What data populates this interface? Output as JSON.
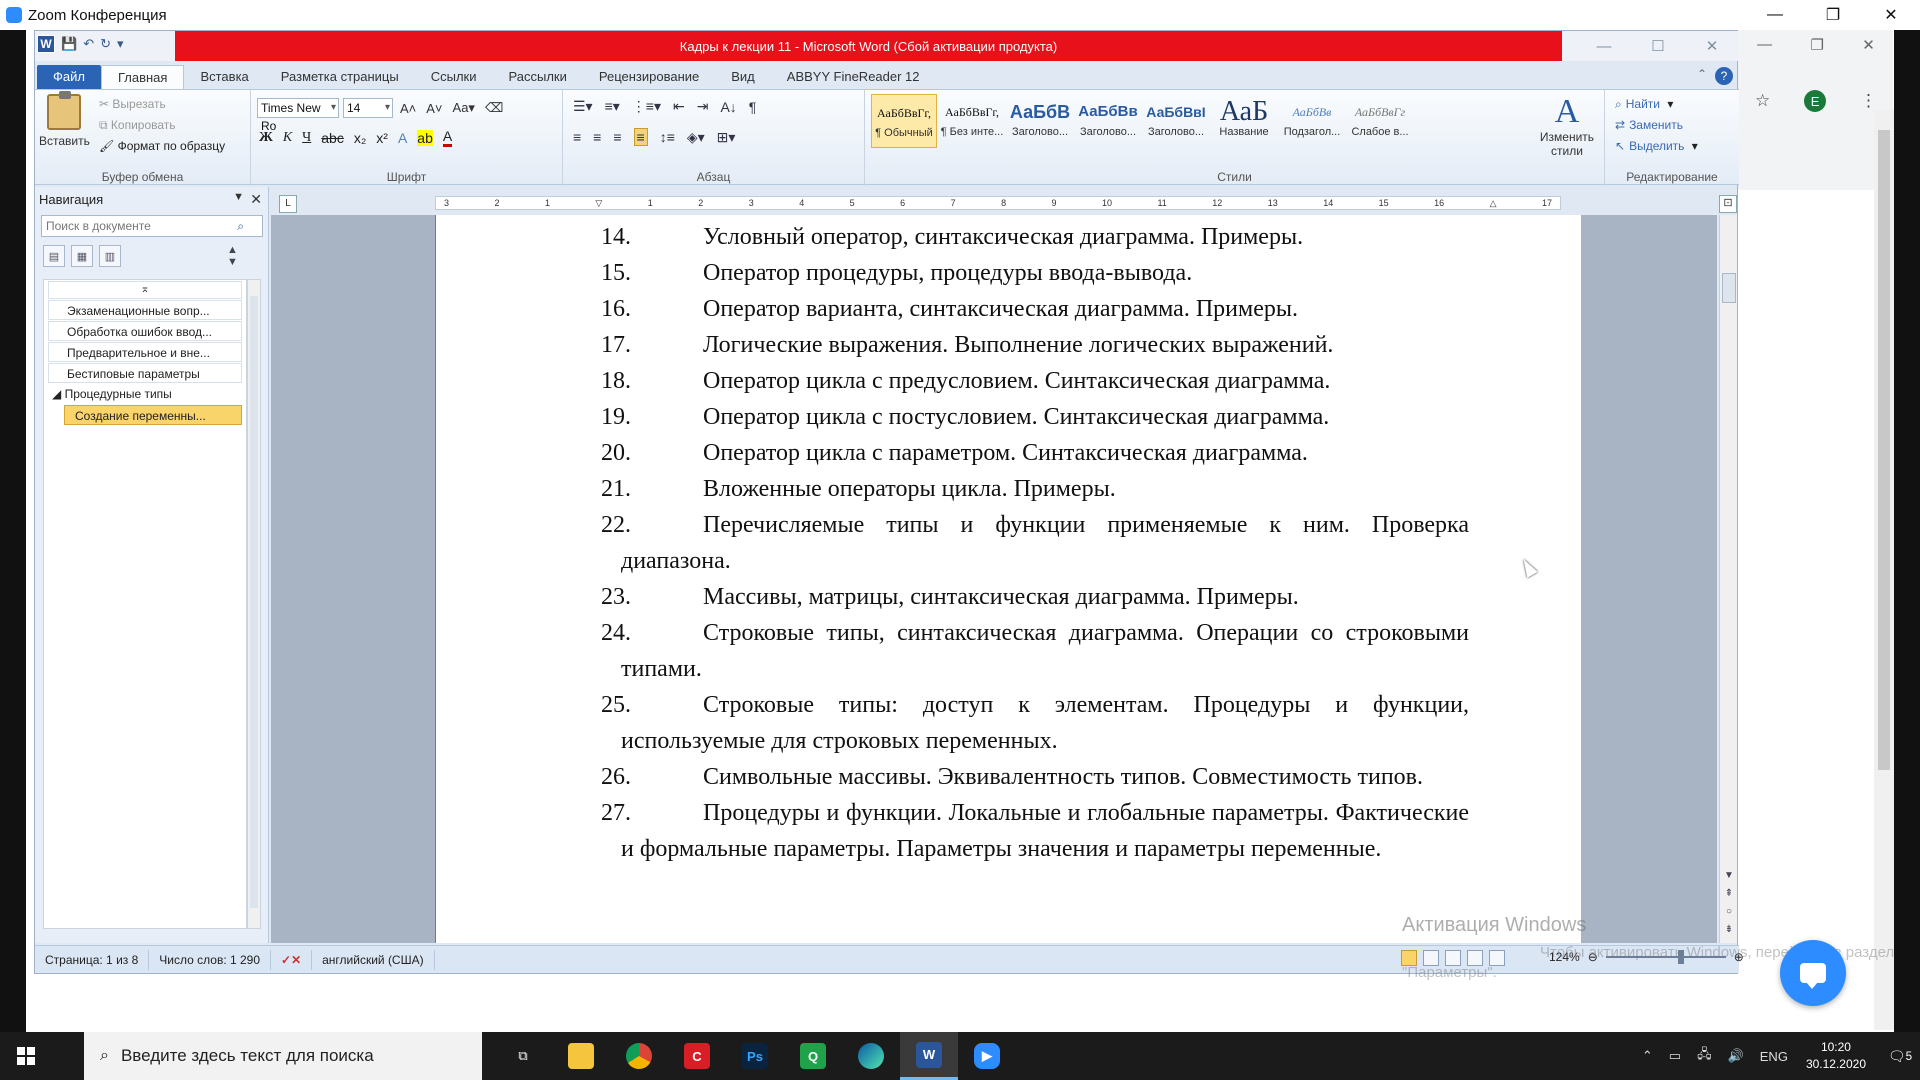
{
  "zoom": {
    "title": "Zoom Конференция",
    "controls": [
      "—",
      "❐",
      "✕"
    ]
  },
  "browser_bg": {
    "controls": [
      "—",
      "❐",
      "✕"
    ],
    "star": "☆",
    "avatar": "E",
    "menu": "⋮"
  },
  "word": {
    "title": "Кадры к лекции 11 - Microsoft Word (Сбой активации продукта)",
    "window_controls": [
      "—",
      "☐",
      "✕"
    ],
    "tabs": [
      "Файл",
      "Главная",
      "Вставка",
      "Разметка страницы",
      "Ссылки",
      "Рассылки",
      "Рецензирование",
      "Вид",
      "ABBYY FineReader 12"
    ],
    "help": "?",
    "clipboard": {
      "paste": "Вставить",
      "cut": "Вырезать",
      "copy": "Копировать",
      "format_painter": "Формат по образцу",
      "group": "Буфер обмена"
    },
    "font": {
      "name": "Times New Ro",
      "size": "14",
      "group": "Шрифт"
    },
    "paragraph": {
      "group": "Абзац"
    },
    "styles": {
      "items": [
        {
          "sample": "АаБбВвГг,",
          "name": "¶ Обычный"
        },
        {
          "sample": "АаБбВвГг,",
          "name": "¶ Без инте..."
        },
        {
          "sample": "АаБбВ",
          "name": "Заголово..."
        },
        {
          "sample": "АаБбВв",
          "name": "Заголово..."
        },
        {
          "sample": "АаБбВвІ",
          "name": "Заголово..."
        },
        {
          "sample": "АаБ",
          "name": "Название"
        },
        {
          "sample": "АаБбВв",
          "name": "Подзагол..."
        },
        {
          "sample": "АаБбВвГг",
          "name": "Слабое в..."
        }
      ],
      "change": "Изменить стили",
      "group": "Стили"
    },
    "editing": {
      "find": "Найти",
      "replace": "Заменить",
      "select": "Выделить",
      "group": "Редактирование"
    }
  },
  "nav": {
    "title": "Навигация",
    "search_placeholder": "Поиск в документе",
    "items": [
      "Экзаменационные вопр...",
      "Обработка ошибок ввод...",
      "Предварительное и вне...",
      "Бестиповые параметры",
      "Процедурные типы",
      "Создание переменны..."
    ]
  },
  "document": {
    "items": [
      {
        "num": "14.",
        "text": "Условный оператор, синтаксическая диаграмма. Примеры."
      },
      {
        "num": "15.",
        "text": "Оператор процедуры, процедуры ввода-вывода."
      },
      {
        "num": "16.",
        "text": "Оператор варианта, синтаксическая диаграмма. Примеры."
      },
      {
        "num": "17.",
        "text": "Логические выражения. Выполнение логических выражений."
      },
      {
        "num": "18.",
        "text": "Оператор цикла с предусловием. Синтаксическая диаграмма."
      },
      {
        "num": "19.",
        "text": "Оператор цикла с постусловием. Синтаксическая диаграмма."
      },
      {
        "num": "20.",
        "text": "Оператор цикла с параметром. Синтаксическая диаграмма."
      },
      {
        "num": "21.",
        "text": "Вложенные операторы цикла. Примеры."
      },
      {
        "num": "22.",
        "text": "Перечисляемые типы и функции применяемые к ним. Проверка диапазона."
      },
      {
        "num": "23.",
        "text": "Массивы, матрицы, синтаксическая диаграмма. Примеры."
      },
      {
        "num": "24.",
        "text": "Строковые типы, синтаксическая диаграмма. Операции со строковыми типами."
      },
      {
        "num": "25.",
        "text": "Строковые типы: доступ к элементам. Процедуры и функции, используемые для строковых переменных."
      },
      {
        "num": "26.",
        "text": "Символьные массивы. Эквивалентность типов. Совместимость типов."
      },
      {
        "num": "27.",
        "text": "Процедуры и функции. Локальные и глобальные параметры. Фактические и формальные параметры. Параметры значения и параметры переменные."
      }
    ]
  },
  "status": {
    "page": "Страница: 1 из 8",
    "words": "Число слов: 1 290",
    "language": "английский (США)",
    "zoom": "124%"
  },
  "watermark": {
    "line1": "Активация Windows",
    "line2": "Чтобы активировать Windows, перейдите в раздел",
    "line3": "\"Параметры\"."
  },
  "taskbar": {
    "search_placeholder": "Введите здесь текст для поиска",
    "lang": "ENG",
    "time": "10:20",
    "date": "30.12.2020",
    "notifications": "5"
  }
}
